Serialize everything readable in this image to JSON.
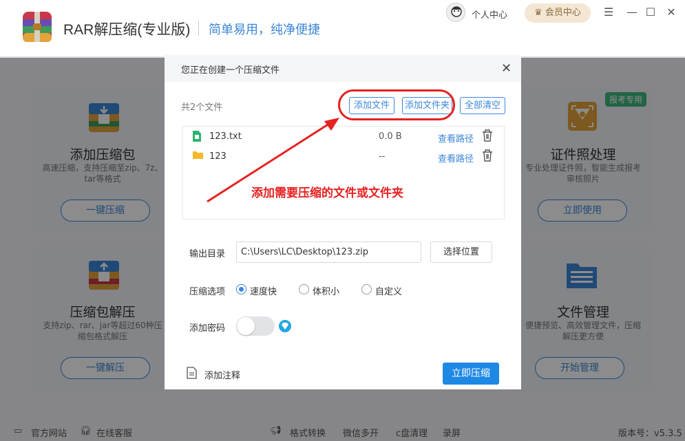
{
  "app": {
    "title": "RAR解压缩(专业版)",
    "slogan": "简单易用，纯净便捷",
    "personal_center": "个人中心",
    "vip_center": "会员中心",
    "menu_icon": "☰",
    "minimize_icon": "—",
    "maximize_icon": "☐",
    "close_icon": "✕"
  },
  "cards": {
    "compress": {
      "title": "添加压缩包",
      "desc": "高速压缩，支持压缩至zip、7z、tar等格式",
      "button": "一键压缩"
    },
    "extract": {
      "title": "压缩包解压",
      "desc": "支持zip、rar、jar等超过60种压缩包格式解压",
      "button": "一键解压"
    },
    "idphoto": {
      "title": "证件照处理",
      "desc": "专业处理证件照，智能生成报考审核照片",
      "button": "立即使用",
      "badge": "报考专用"
    },
    "files": {
      "title": "文件管理",
      "desc": "便捷预览、高效管理文件，压缩解压更方便",
      "button": "开始管理"
    }
  },
  "footer": {
    "website": "官方网站",
    "service": "在线客服",
    "convert": "格式转换",
    "wechat": "微信多开",
    "cclean": "c盘清理",
    "record": "录屏",
    "version": "版本号：v5.3.5"
  },
  "dialog": {
    "title": "您正在创建一个压缩文件",
    "close_icon": "✕",
    "file_count": "共2个文件",
    "add_file": "添加文件",
    "add_folder": "添加文件夹",
    "clear_all": "全部清空",
    "files": [
      {
        "name": "123.txt",
        "size": "0.0 B",
        "action": "查看路径"
      },
      {
        "name": "123",
        "size": "--",
        "action": "查看路径"
      }
    ],
    "annotation": "添加需要压缩的文件或文件夹",
    "output_label": "输出目录",
    "output_value": "C:\\Users\\LC\\Desktop\\123.zip",
    "choose_location": "选择位置",
    "options_label": "压缩选项",
    "options": [
      "速度快",
      "体积小",
      "自定义"
    ],
    "selected_option": "速度快",
    "password_label": "添加密码",
    "password_enabled": false,
    "comment_label": "添加注释",
    "compress_now": "立即压缩"
  },
  "colors": {
    "accent": "#3b86d8",
    "primary_button": "#1e88e5",
    "annotation_red": "#e62121"
  }
}
